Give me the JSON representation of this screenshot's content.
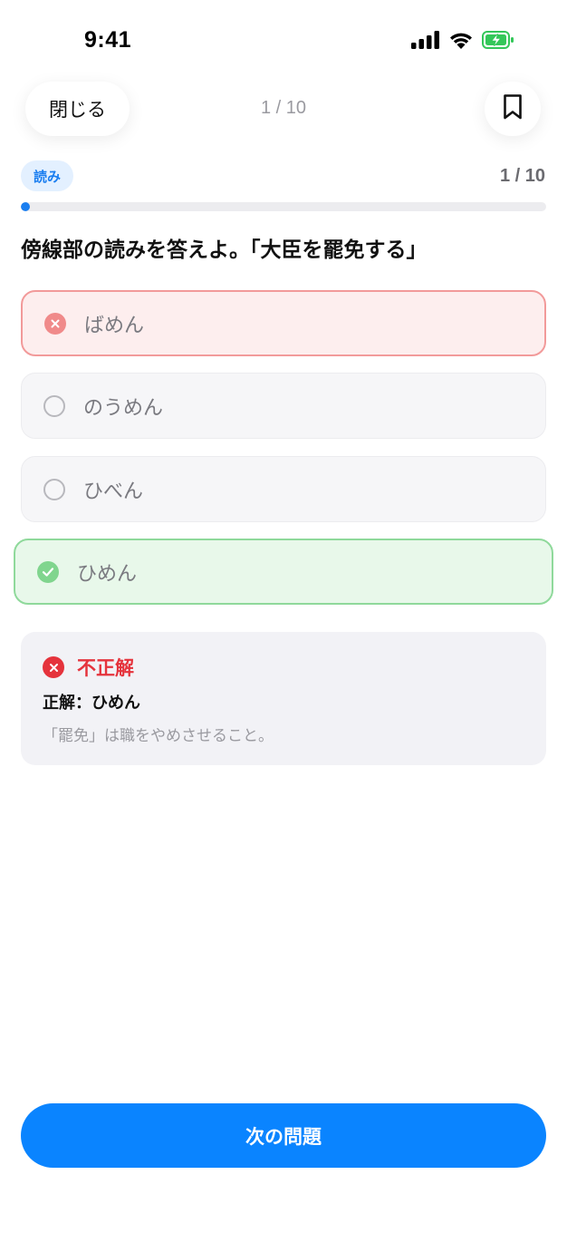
{
  "status_bar": {
    "time": "9:41",
    "icons": [
      "signal-icon",
      "wifi-icon",
      "battery-charging-icon"
    ]
  },
  "nav": {
    "close_label": "閉じる",
    "counter": "1 / 10",
    "bookmark_icon": "bookmark-icon"
  },
  "quiz": {
    "category": "読み",
    "progress_label": "1 / 10",
    "progress_fraction": 0.0,
    "question": "傍線部の読みを答えよ。「大臣を罷免する」",
    "choices": [
      {
        "label": "ばめん",
        "state": "wrong"
      },
      {
        "label": "のうめん",
        "state": "default"
      },
      {
        "label": "ひべん",
        "state": "default"
      },
      {
        "label": "ひめん",
        "state": "correct"
      }
    ]
  },
  "feedback": {
    "status": "不正解",
    "answer_text": "正解：ひめん",
    "explanation": "「罷免」は職をやめさせること。"
  },
  "actions": {
    "next_label": "次の問題"
  },
  "colors": {
    "accent": "#0a84ff",
    "wrong": "#e5333c",
    "wrong_bg": "#fdeeee",
    "correct_bg": "#e8f8ea",
    "badge_bg": "#e3f0ff"
  }
}
